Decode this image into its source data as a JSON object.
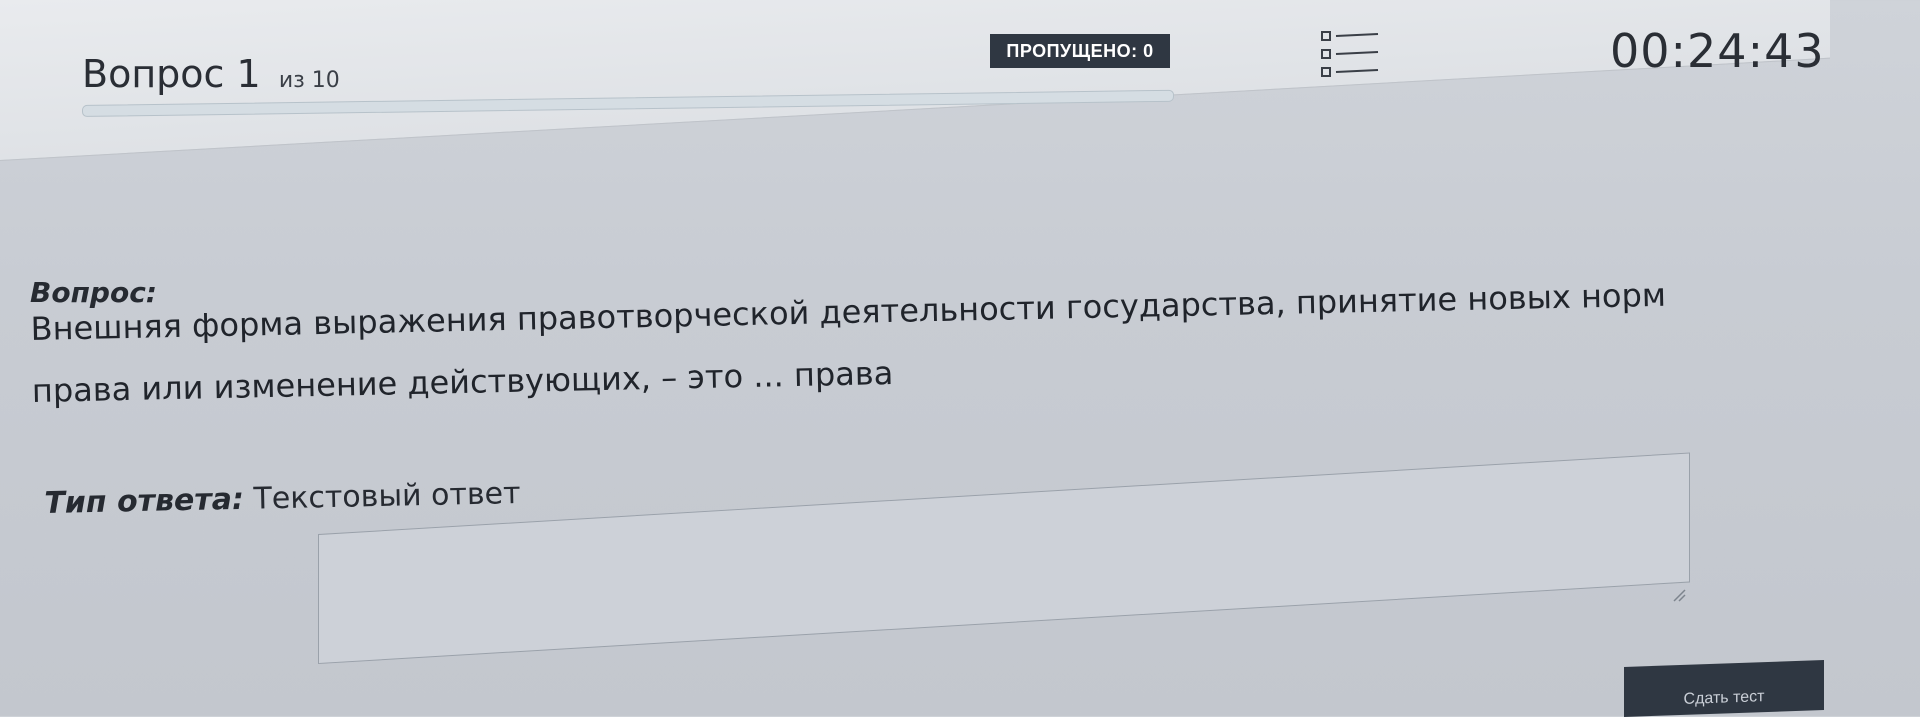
{
  "header": {
    "question_word": "Вопрос",
    "question_number": "1",
    "question_of_total": "из 10",
    "skipped_label": "ПРОПУЩЕНО: 0",
    "timer": "00:24:43",
    "progress": 0
  },
  "question": {
    "label": "Вопрос:",
    "text": "Внешняя форма выражения правотворческой деятельности государства, принятие новых норм права или изменение действующих, – это ... права"
  },
  "answer": {
    "type_label": "Тип ответа:",
    "type_value": "Текстовый ответ",
    "value": ""
  },
  "footer": {
    "end_button_label": "Сдать тест"
  },
  "colors": {
    "badge_bg": "#2f3742",
    "badge_text": "#ffffff",
    "background": "#c8ccd3"
  }
}
